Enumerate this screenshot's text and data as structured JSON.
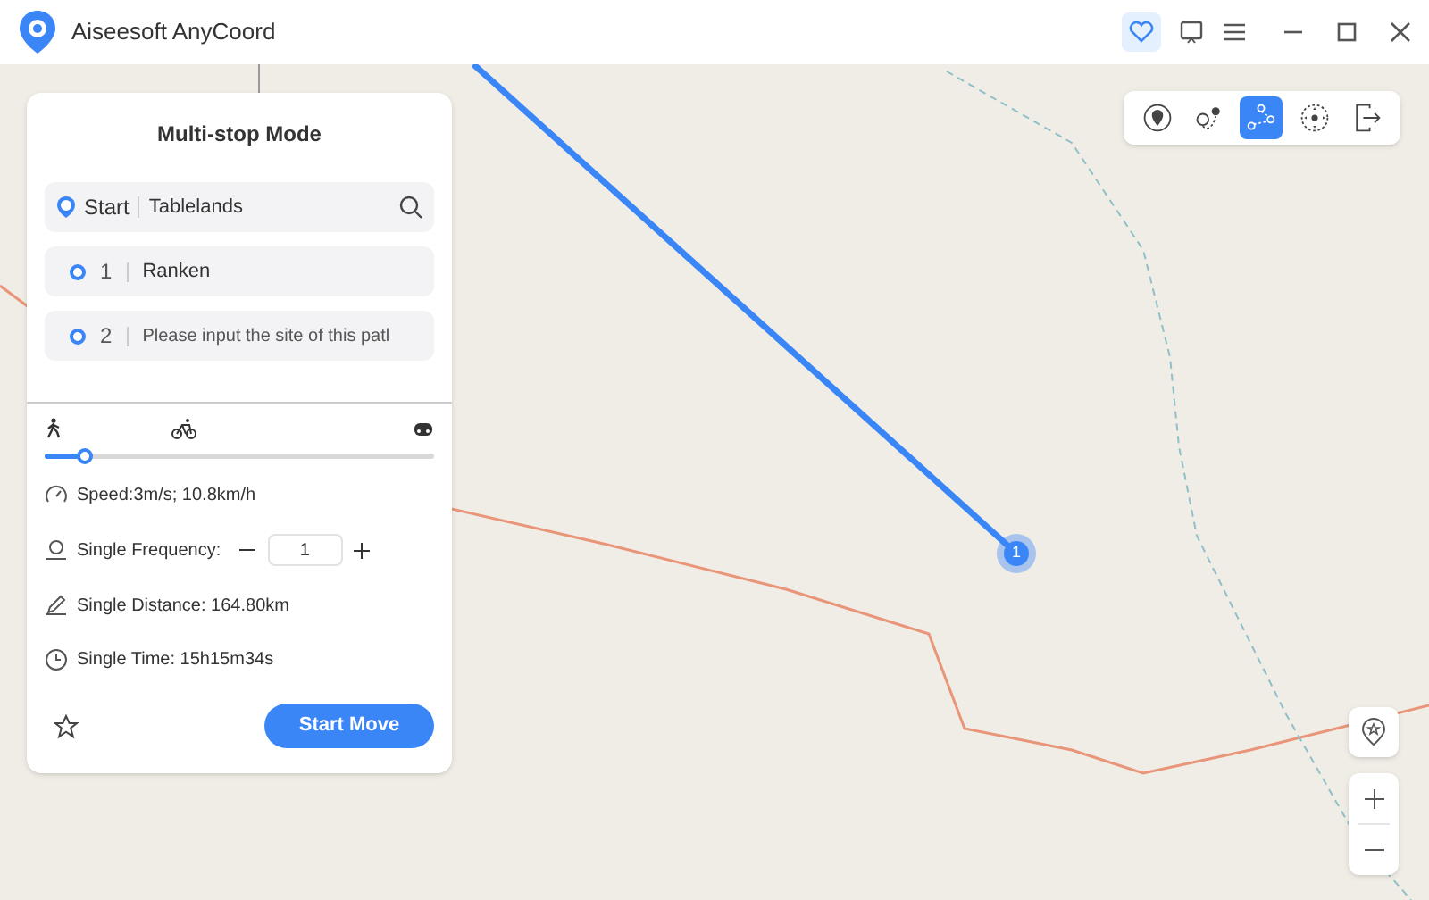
{
  "window": {
    "title": "Aiseesoft AnyCoord"
  },
  "toolbar": [
    {
      "kind": "teleport",
      "selected": false
    },
    {
      "kind": "one-stop",
      "selected": false
    },
    {
      "kind": "multi-stop",
      "selected": true
    },
    {
      "kind": "joystick",
      "selected": false
    },
    {
      "kind": "exit",
      "selected": false
    }
  ],
  "panel": {
    "title": "Multi-stop Mode",
    "start": {
      "label": "Start",
      "value": "Tablelands"
    },
    "stops": [
      {
        "number": "1",
        "value": "Ranken"
      },
      {
        "number": "2",
        "placeholder": "Please input the site of this patl"
      }
    ],
    "speed_slider": {
      "level": 0.1
    },
    "speed": "Speed:3m/s; 10.8km/h",
    "frequency": {
      "label": "Single Frequency:",
      "value": "1"
    },
    "distance": "Single Distance: 164.80km",
    "time": "Single Time: 15h15m34s",
    "start_button": "Start Move"
  },
  "map": {
    "marker": "1"
  }
}
